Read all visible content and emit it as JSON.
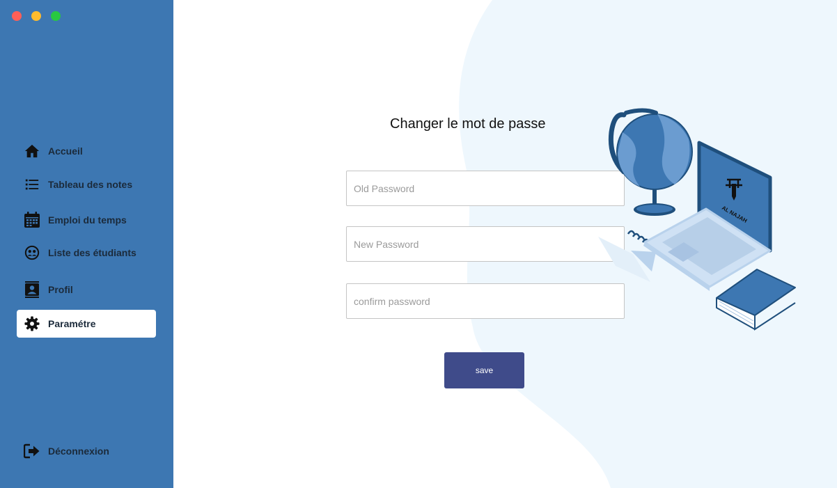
{
  "window": {
    "controls": [
      {
        "name": "close",
        "color": "#ff5f57"
      },
      {
        "name": "minimize",
        "color": "#febc2e"
      },
      {
        "name": "maximize",
        "color": "#28c840"
      }
    ]
  },
  "sidebar": {
    "items": [
      {
        "label": "Accueil",
        "icon": "home-icon"
      },
      {
        "label": "Tableau des notes",
        "icon": "list-icon"
      },
      {
        "label": "Emploi du temps",
        "icon": "calendar-icon"
      },
      {
        "label": "Liste des étudiants",
        "icon": "students-icon"
      },
      {
        "label": "Profil",
        "icon": "profile-icon"
      },
      {
        "label": "Paramétre",
        "icon": "gear-icon",
        "active": true
      }
    ],
    "logout": {
      "label": "Déconnexion",
      "icon": "logout-icon"
    },
    "colors": {
      "background": "#3d77b2",
      "active_background": "#ffffff"
    }
  },
  "form": {
    "title": "Changer le mot de passe",
    "old_password": {
      "placeholder": "Old Password",
      "value": ""
    },
    "new_password": {
      "placeholder": "New Password",
      "value": ""
    },
    "confirm_password": {
      "placeholder": "confirm password",
      "value": ""
    },
    "save_label": "save",
    "save_color": "#3f4b8a"
  },
  "illustration": {
    "laptop_logo_text": "AL NAJAH",
    "colors": {
      "accent": "#3d77b2",
      "light": "#c9dcf2",
      "background_wave": "#eef7fd"
    }
  }
}
